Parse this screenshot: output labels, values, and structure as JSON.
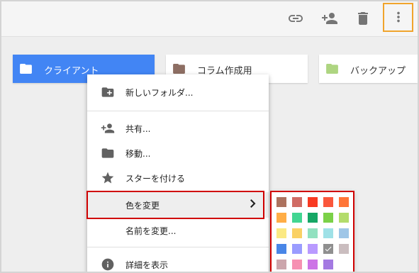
{
  "toolbar": {
    "link_icon": "link-icon",
    "add_person_icon": "person-add-icon",
    "delete_icon": "trash-icon",
    "more_icon": "more-vert-icon"
  },
  "folders": [
    {
      "label": "クライアント",
      "color": "#ffffff",
      "selected": true
    },
    {
      "label": "コラム作成用",
      "color": "#8d6e63",
      "selected": false
    },
    {
      "label": "バックアップ",
      "color": "#aed581",
      "selected": false
    }
  ],
  "menu": {
    "items": [
      {
        "label": "新しいフォルダ...",
        "icon": "folder-add-icon"
      },
      {
        "label": "共有...",
        "icon": "person-add-icon"
      },
      {
        "label": "移動...",
        "icon": "folder-icon"
      },
      {
        "label": "スターを付ける",
        "icon": "star-icon"
      },
      {
        "label": "色を変更",
        "icon": "",
        "highlighted": true
      },
      {
        "label": "名前を変更...",
        "icon": ""
      },
      {
        "label": "詳細を表示",
        "icon": "info-icon"
      }
    ]
  },
  "palette": {
    "colors": [
      [
        "#ac725e",
        "#d06b64",
        "#f83a22",
        "#fa573c",
        "#ff7537"
      ],
      [
        "#ffad46",
        "#42d692",
        "#16a765",
        "#7bd148",
        "#b3dc6c"
      ],
      [
        "#fbe983",
        "#fad165",
        "#92e1c0",
        "#9fe1e7",
        "#9fc6e7"
      ],
      [
        "#4986e7",
        "#9a9cff",
        "#b99aff",
        "#8f8f8f",
        "#cabdbf"
      ],
      [
        "#cca6ac",
        "#f691b2",
        "#cd74e6",
        "#a47ae2",
        ""
      ]
    ],
    "selected": "#8f8f8f"
  }
}
